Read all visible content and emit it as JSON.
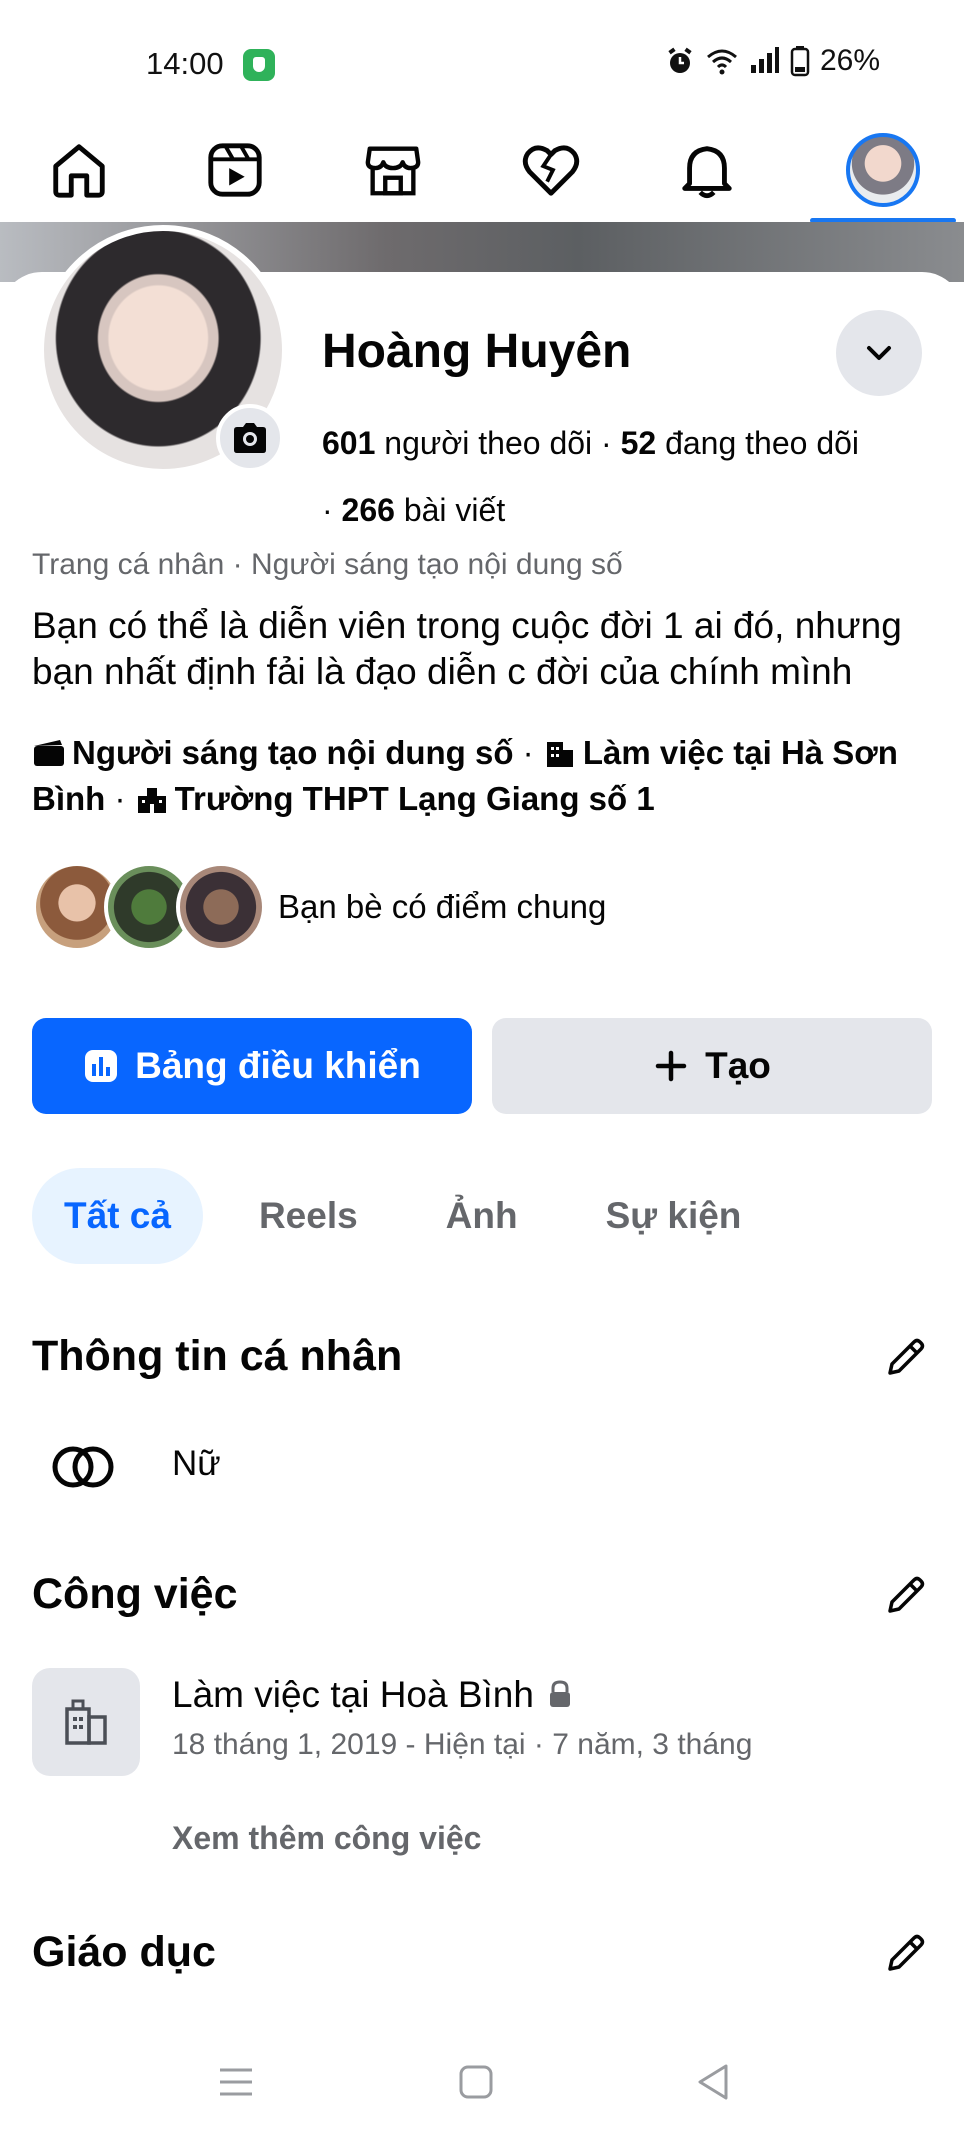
{
  "status_bar": {
    "time": "14:00",
    "battery": "26%"
  },
  "nav": {
    "items": [
      "home-icon",
      "reels-icon",
      "marketplace-icon",
      "dating-icon",
      "notifications-icon",
      "profile-avatar"
    ],
    "active": "profile-avatar"
  },
  "profile": {
    "name": "Hoàng Huyên",
    "followers_count": "601",
    "followers_label": "người theo dõi",
    "following_count": "52",
    "following_label": "đang theo dõi",
    "posts_count": "266",
    "posts_label": "bài viết",
    "category": "Trang cá nhân · Người sáng tạo nội dung số",
    "bio": "Bạn có thể là diễn viên trong cuộc đời 1 ai đó, nhưng bạn nhất định fải là đạo diễn c đời của chính mình",
    "detail_creator": "Người sáng tạo nội dung số",
    "detail_work": "Làm việc tại Hà Sơn Bình",
    "detail_school": "Trường THPT Lạng Giang số 1",
    "mutual_label": "Bạn bè có điểm chung"
  },
  "actions": {
    "dashboard_label": "Bảng điều khiển",
    "create_label": "Tạo"
  },
  "tabs": [
    "Tất cả",
    "Reels",
    "Ảnh",
    "Sự kiện"
  ],
  "about": {
    "personal_title": "Thông tin cá nhân",
    "gender": "Nữ",
    "work_title": "Công việc",
    "work_place": "Làm việc tại Hoà Bình",
    "work_period": "18 tháng 1, 2019 - Hiện tại · 7 năm, 3 tháng",
    "see_more_work": "Xem thêm công việc",
    "education_title": "Giáo dục"
  },
  "colors": {
    "accent": "#0866ff",
    "secondary_bg": "#e4e6eb",
    "muted_text": "#65676b",
    "active_tab_bg": "#e7f3ff"
  }
}
